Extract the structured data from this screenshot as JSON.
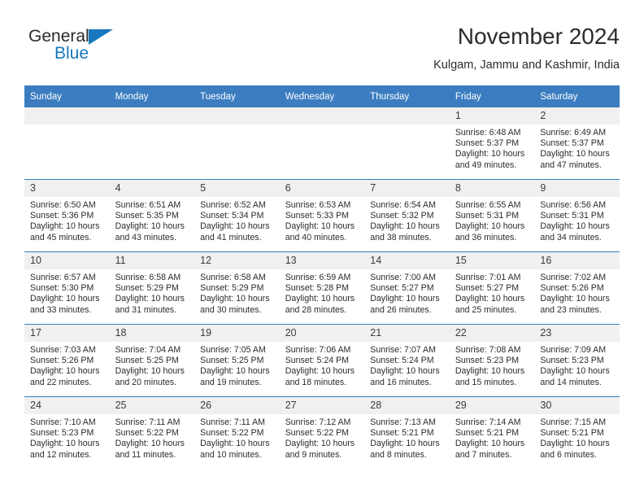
{
  "logo": {
    "word1": "General",
    "word2": "Blue",
    "triangle_color": "#1878be"
  },
  "header": {
    "title": "November 2024",
    "subtitle": "Kulgam, Jammu and Kashmir, India"
  },
  "theme": {
    "header_blue": "#3b7dc0",
    "daynum_band": "#f0f0f0",
    "text": "#2b2b2b"
  },
  "calendar": {
    "weekday_headers": [
      "Sunday",
      "Monday",
      "Tuesday",
      "Wednesday",
      "Thursday",
      "Friday",
      "Saturday"
    ],
    "weeks": [
      [
        {
          "date": "",
          "blank": true,
          "sunrise": "",
          "sunset": "",
          "daylight_line1": "",
          "daylight_line2": ""
        },
        {
          "date": "",
          "blank": true,
          "sunrise": "",
          "sunset": "",
          "daylight_line1": "",
          "daylight_line2": ""
        },
        {
          "date": "",
          "blank": true,
          "sunrise": "",
          "sunset": "",
          "daylight_line1": "",
          "daylight_line2": ""
        },
        {
          "date": "",
          "blank": true,
          "sunrise": "",
          "sunset": "",
          "daylight_line1": "",
          "daylight_line2": ""
        },
        {
          "date": "",
          "blank": true,
          "sunrise": "",
          "sunset": "",
          "daylight_line1": "",
          "daylight_line2": ""
        },
        {
          "date": "1",
          "blank": false,
          "sunrise": "Sunrise: 6:48 AM",
          "sunset": "Sunset: 5:37 PM",
          "daylight_line1": "Daylight: 10 hours",
          "daylight_line2": "and 49 minutes."
        },
        {
          "date": "2",
          "blank": false,
          "sunrise": "Sunrise: 6:49 AM",
          "sunset": "Sunset: 5:37 PM",
          "daylight_line1": "Daylight: 10 hours",
          "daylight_line2": "and 47 minutes."
        }
      ],
      [
        {
          "date": "3",
          "blank": false,
          "sunrise": "Sunrise: 6:50 AM",
          "sunset": "Sunset: 5:36 PM",
          "daylight_line1": "Daylight: 10 hours",
          "daylight_line2": "and 45 minutes."
        },
        {
          "date": "4",
          "blank": false,
          "sunrise": "Sunrise: 6:51 AM",
          "sunset": "Sunset: 5:35 PM",
          "daylight_line1": "Daylight: 10 hours",
          "daylight_line2": "and 43 minutes."
        },
        {
          "date": "5",
          "blank": false,
          "sunrise": "Sunrise: 6:52 AM",
          "sunset": "Sunset: 5:34 PM",
          "daylight_line1": "Daylight: 10 hours",
          "daylight_line2": "and 41 minutes."
        },
        {
          "date": "6",
          "blank": false,
          "sunrise": "Sunrise: 6:53 AM",
          "sunset": "Sunset: 5:33 PM",
          "daylight_line1": "Daylight: 10 hours",
          "daylight_line2": "and 40 minutes."
        },
        {
          "date": "7",
          "blank": false,
          "sunrise": "Sunrise: 6:54 AM",
          "sunset": "Sunset: 5:32 PM",
          "daylight_line1": "Daylight: 10 hours",
          "daylight_line2": "and 38 minutes."
        },
        {
          "date": "8",
          "blank": false,
          "sunrise": "Sunrise: 6:55 AM",
          "sunset": "Sunset: 5:31 PM",
          "daylight_line1": "Daylight: 10 hours",
          "daylight_line2": "and 36 minutes."
        },
        {
          "date": "9",
          "blank": false,
          "sunrise": "Sunrise: 6:56 AM",
          "sunset": "Sunset: 5:31 PM",
          "daylight_line1": "Daylight: 10 hours",
          "daylight_line2": "and 34 minutes."
        }
      ],
      [
        {
          "date": "10",
          "blank": false,
          "sunrise": "Sunrise: 6:57 AM",
          "sunset": "Sunset: 5:30 PM",
          "daylight_line1": "Daylight: 10 hours",
          "daylight_line2": "and 33 minutes."
        },
        {
          "date": "11",
          "blank": false,
          "sunrise": "Sunrise: 6:58 AM",
          "sunset": "Sunset: 5:29 PM",
          "daylight_line1": "Daylight: 10 hours",
          "daylight_line2": "and 31 minutes."
        },
        {
          "date": "12",
          "blank": false,
          "sunrise": "Sunrise: 6:58 AM",
          "sunset": "Sunset: 5:29 PM",
          "daylight_line1": "Daylight: 10 hours",
          "daylight_line2": "and 30 minutes."
        },
        {
          "date": "13",
          "blank": false,
          "sunrise": "Sunrise: 6:59 AM",
          "sunset": "Sunset: 5:28 PM",
          "daylight_line1": "Daylight: 10 hours",
          "daylight_line2": "and 28 minutes."
        },
        {
          "date": "14",
          "blank": false,
          "sunrise": "Sunrise: 7:00 AM",
          "sunset": "Sunset: 5:27 PM",
          "daylight_line1": "Daylight: 10 hours",
          "daylight_line2": "and 26 minutes."
        },
        {
          "date": "15",
          "blank": false,
          "sunrise": "Sunrise: 7:01 AM",
          "sunset": "Sunset: 5:27 PM",
          "daylight_line1": "Daylight: 10 hours",
          "daylight_line2": "and 25 minutes."
        },
        {
          "date": "16",
          "blank": false,
          "sunrise": "Sunrise: 7:02 AM",
          "sunset": "Sunset: 5:26 PM",
          "daylight_line1": "Daylight: 10 hours",
          "daylight_line2": "and 23 minutes."
        }
      ],
      [
        {
          "date": "17",
          "blank": false,
          "sunrise": "Sunrise: 7:03 AM",
          "sunset": "Sunset: 5:26 PM",
          "daylight_line1": "Daylight: 10 hours",
          "daylight_line2": "and 22 minutes."
        },
        {
          "date": "18",
          "blank": false,
          "sunrise": "Sunrise: 7:04 AM",
          "sunset": "Sunset: 5:25 PM",
          "daylight_line1": "Daylight: 10 hours",
          "daylight_line2": "and 20 minutes."
        },
        {
          "date": "19",
          "blank": false,
          "sunrise": "Sunrise: 7:05 AM",
          "sunset": "Sunset: 5:25 PM",
          "daylight_line1": "Daylight: 10 hours",
          "daylight_line2": "and 19 minutes."
        },
        {
          "date": "20",
          "blank": false,
          "sunrise": "Sunrise: 7:06 AM",
          "sunset": "Sunset: 5:24 PM",
          "daylight_line1": "Daylight: 10 hours",
          "daylight_line2": "and 18 minutes."
        },
        {
          "date": "21",
          "blank": false,
          "sunrise": "Sunrise: 7:07 AM",
          "sunset": "Sunset: 5:24 PM",
          "daylight_line1": "Daylight: 10 hours",
          "daylight_line2": "and 16 minutes."
        },
        {
          "date": "22",
          "blank": false,
          "sunrise": "Sunrise: 7:08 AM",
          "sunset": "Sunset: 5:23 PM",
          "daylight_line1": "Daylight: 10 hours",
          "daylight_line2": "and 15 minutes."
        },
        {
          "date": "23",
          "blank": false,
          "sunrise": "Sunrise: 7:09 AM",
          "sunset": "Sunset: 5:23 PM",
          "daylight_line1": "Daylight: 10 hours",
          "daylight_line2": "and 14 minutes."
        }
      ],
      [
        {
          "date": "24",
          "blank": false,
          "sunrise": "Sunrise: 7:10 AM",
          "sunset": "Sunset: 5:23 PM",
          "daylight_line1": "Daylight: 10 hours",
          "daylight_line2": "and 12 minutes."
        },
        {
          "date": "25",
          "blank": false,
          "sunrise": "Sunrise: 7:11 AM",
          "sunset": "Sunset: 5:22 PM",
          "daylight_line1": "Daylight: 10 hours",
          "daylight_line2": "and 11 minutes."
        },
        {
          "date": "26",
          "blank": false,
          "sunrise": "Sunrise: 7:11 AM",
          "sunset": "Sunset: 5:22 PM",
          "daylight_line1": "Daylight: 10 hours",
          "daylight_line2": "and 10 minutes."
        },
        {
          "date": "27",
          "blank": false,
          "sunrise": "Sunrise: 7:12 AM",
          "sunset": "Sunset: 5:22 PM",
          "daylight_line1": "Daylight: 10 hours",
          "daylight_line2": "and 9 minutes."
        },
        {
          "date": "28",
          "blank": false,
          "sunrise": "Sunrise: 7:13 AM",
          "sunset": "Sunset: 5:21 PM",
          "daylight_line1": "Daylight: 10 hours",
          "daylight_line2": "and 8 minutes."
        },
        {
          "date": "29",
          "blank": false,
          "sunrise": "Sunrise: 7:14 AM",
          "sunset": "Sunset: 5:21 PM",
          "daylight_line1": "Daylight: 10 hours",
          "daylight_line2": "and 7 minutes."
        },
        {
          "date": "30",
          "blank": false,
          "sunrise": "Sunrise: 7:15 AM",
          "sunset": "Sunset: 5:21 PM",
          "daylight_line1": "Daylight: 10 hours",
          "daylight_line2": "and 6 minutes."
        }
      ]
    ]
  }
}
